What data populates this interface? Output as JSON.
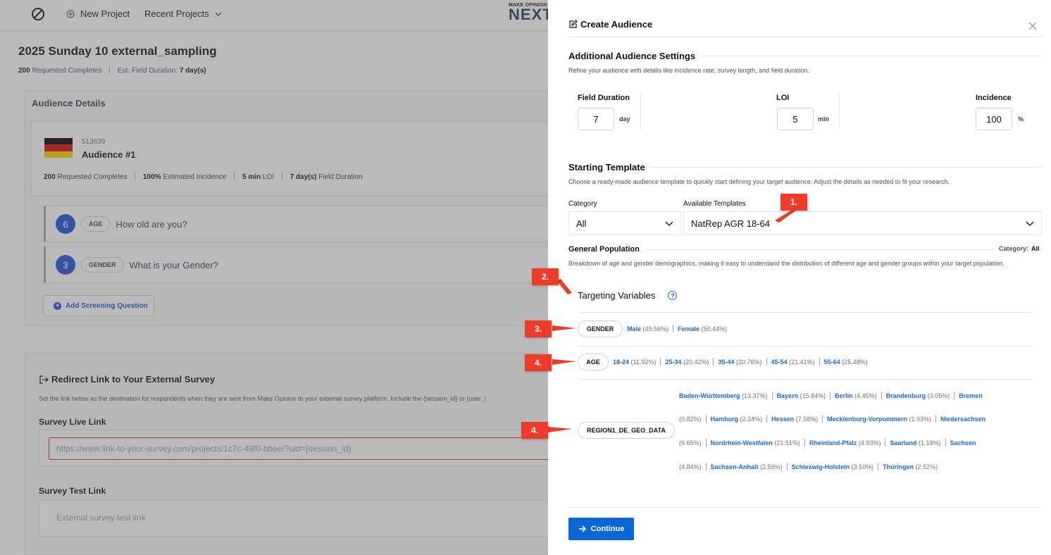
{
  "topbar": {
    "new_project": "New Project",
    "recent_projects": "Recent Projects",
    "brand_small": "MAKE OPINION",
    "brand_big": "NEXT"
  },
  "project": {
    "title": "2025 Sunday 10 external_sampling",
    "requested_value": "200",
    "requested_label": "Requested Completes",
    "duration_label": "Est. Field Duration:",
    "duration_value": "7 day(s)"
  },
  "audience": {
    "heading": "Audience Details",
    "id": "513639",
    "name": "Audience #1",
    "stats": {
      "completes_value": "200",
      "completes_label": "Requested Completes",
      "incidence_value": "100%",
      "incidence_label": "Estimated Incidence",
      "loi_value": "5 min",
      "loi_label": "LOI",
      "duration_value": "7 day(s)",
      "duration_label": "Field Duration"
    },
    "questions": [
      {
        "num": "6",
        "tag": "AGE",
        "text": "How old are you?"
      },
      {
        "num": "3",
        "tag": "GENDER",
        "text": "What is your Gender?"
      }
    ],
    "add_question": "Add Screening Question"
  },
  "redirect": {
    "title": "Redirect Link to Your External Survey",
    "desc": "Set the link below as the destination for respondents when they are sent from Make Opinion to your external survey platform. Include the {session_id} or {user_i",
    "live_label": "Survey Live Link",
    "live_placeholder": "https://www.link-to-your-survey.com/projects/1c7c-49f0-bbee/?uid={session_id}",
    "test_label": "Survey Test Link",
    "test_placeholder": "External survey test link"
  },
  "drawer": {
    "title": "Create Audience",
    "additional": {
      "title": "Additional Audience Settings",
      "desc": "Refine your audience with details like incidence rate, survey length, and field duration.",
      "field_duration_label": "Field Duration",
      "field_duration_value": "7",
      "field_duration_unit": "day",
      "loi_label": "LOI",
      "loi_value": "5",
      "loi_unit": "min",
      "incidence_label": "Incidence",
      "incidence_value": "100",
      "incidence_unit": "%"
    },
    "template": {
      "title": "Starting Template",
      "desc": "Choose a ready-made audience template to quickly start defining your target audience. Adjust the details as needed to fit your research.",
      "category_label": "Category",
      "category_value": "All",
      "templates_label": "Available Templates",
      "templates_value": "NatRep AGR 18-64"
    },
    "general_population": {
      "title": "General Population",
      "category_label": "Category:",
      "category_value": "All",
      "desc": "Breakdown of age and gender demographics, making it easy to understand the distribution of different age and gender groups within your target population."
    },
    "targeting_title": "Targeting Variables",
    "variables": {
      "gender": {
        "name": "GENDER",
        "options": [
          {
            "name": "Male",
            "pct": "(49.56%)"
          },
          {
            "name": "Female",
            "pct": "(50.44%)"
          }
        ]
      },
      "age": {
        "name": "AGE",
        "options": [
          {
            "name": "18-24",
            "pct": "(11.92%)"
          },
          {
            "name": "25-34",
            "pct": "(20.42%)"
          },
          {
            "name": "35-44",
            "pct": "(20.78%)"
          },
          {
            "name": "45-54",
            "pct": "(21.41%)"
          },
          {
            "name": "55-64",
            "pct": "(25.48%)"
          }
        ]
      },
      "region": {
        "name": "REGION1_DE_GEO_DATA",
        "options": [
          {
            "name": "Baden-Württemberg",
            "pct": "(13.37%)"
          },
          {
            "name": "Bayern",
            "pct": "(15.84%)"
          },
          {
            "name": "Berlin",
            "pct": "(4.45%)"
          },
          {
            "name": "Brandenburg",
            "pct": "(3.05%)"
          },
          {
            "name": "Bremen",
            "pct": "(0.82%)"
          },
          {
            "name": "Hamburg",
            "pct": "(2.24%)"
          },
          {
            "name": "Hessen",
            "pct": "(7.58%)"
          },
          {
            "name": "Mecklenburg-Vorpommern",
            "pct": "(1.93%)"
          },
          {
            "name": "Niedersachsen",
            "pct": "(9.65%)"
          },
          {
            "name": "Nordrhein-Westfalen",
            "pct": "(21.51%)"
          },
          {
            "name": "Rheinland-Pfalz",
            "pct": "(4.93%)"
          },
          {
            "name": "Saarland",
            "pct": "(1.18%)"
          },
          {
            "name": "Sachsen",
            "pct": "(4.84%)"
          },
          {
            "name": "Sachsen-Anhalt",
            "pct": "(2.59%)"
          },
          {
            "name": "Schleswig-Holstein",
            "pct": "(3.50%)"
          },
          {
            "name": "Thüringen",
            "pct": "(2.52%)"
          }
        ]
      }
    },
    "continue": "Continue"
  },
  "annotations": [
    "1.",
    "2.",
    "3.",
    "4.",
    "4."
  ],
  "colors": {
    "accent": "#0b66d6",
    "link": "#1d6ad2",
    "annotation": "#ef3b2a",
    "flag": [
      "#000000",
      "#dd0000",
      "#ffce00"
    ]
  }
}
